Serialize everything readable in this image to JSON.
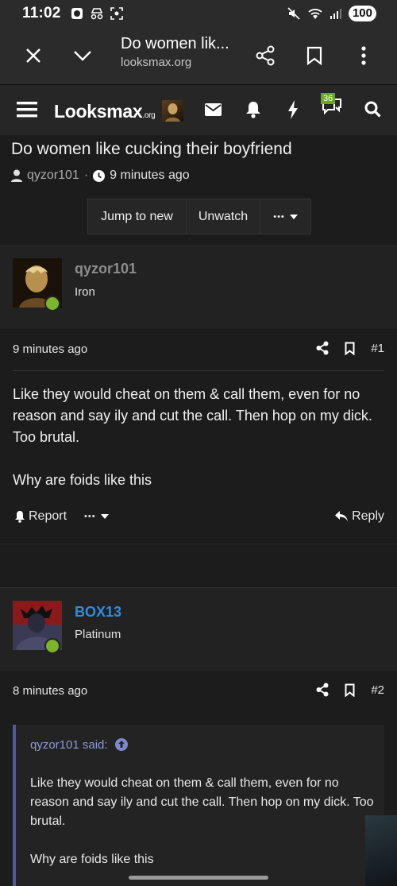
{
  "status_bar": {
    "time": "11:02",
    "battery": "100"
  },
  "browser": {
    "title": "Do women lik...",
    "url": "looksmax.org"
  },
  "site": {
    "logo_main": "Looksmax",
    "logo_suffix": ".org",
    "alerts_badge": "36"
  },
  "thread": {
    "title": "Do women like cucking their boyfriend",
    "author": "qyzor101",
    "separator": "·",
    "time": "9 minutes ago",
    "buttons": {
      "jump": "Jump to new",
      "watch": "Unwatch",
      "more": "•••"
    }
  },
  "posts": [
    {
      "username": "qyzor101",
      "rank": "Iron",
      "time": "9 minutes ago",
      "number": "#1",
      "text_1": "Like they would cheat on them & call them, even for no reason and say ily and cut the call. Then hop on my dick. Too brutal.",
      "text_2": "Why are foids like this",
      "report": "Report",
      "more": "•••",
      "reply": "Reply"
    },
    {
      "username": "BOX13",
      "rank": "Platinum",
      "time": "8 minutes ago",
      "number": "#2",
      "quote_by": "qyzor101 said:",
      "quote_1": "Like they would cheat on them & call them, even for no reason and say ily and cut the call. Then hop on my dick. Too brutal.",
      "quote_2": "Why are foids like this"
    }
  ],
  "colors": {
    "accent": "#69a824",
    "username_blue": "#2f8ce0",
    "quote_border": "#4a5aa8"
  }
}
